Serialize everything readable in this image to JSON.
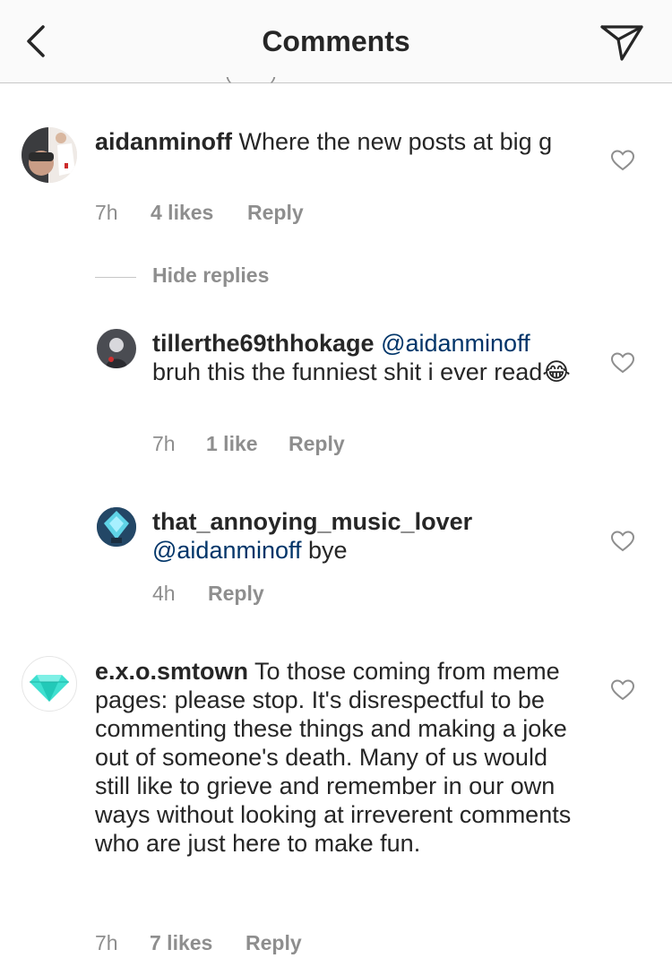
{
  "header": {
    "title": "Comments",
    "back_icon": "chevron-left-icon",
    "share_icon": "paper-plane-icon"
  },
  "comments": [
    {
      "username": "aidanminoff",
      "text": " Where the new posts at big g",
      "time": "7h",
      "likes": "4 likes",
      "reply": "Reply"
    },
    {
      "username": "tillerthe69thhokage",
      "mention": "@aidanminoff",
      "text": " bruh this the funniest shit i ever read",
      "emoji": "😂",
      "time": "7h",
      "likes": "1 like",
      "reply": "Reply"
    },
    {
      "username": "that_annoying_music_lover",
      "mention": "@aidanminoff",
      "text": " bye",
      "time": "4h",
      "reply": "Reply"
    },
    {
      "username": "e.x.o.smtown",
      "text": " To those coming from meme pages: please stop. It's disrespectful to be commenting these things and making a joke out of someone's death. Many of us would still like to grieve and remember in our own ways without looking at irreverent comments who are just here to make fun.",
      "time": "7h",
      "likes": "7 likes",
      "reply": "Reply"
    }
  ],
  "hide_replies": "Hide replies",
  "colors": {
    "text": "#262626",
    "muted": "#8e8e8e",
    "mention": "#003569",
    "header_bg": "#fafafa"
  }
}
